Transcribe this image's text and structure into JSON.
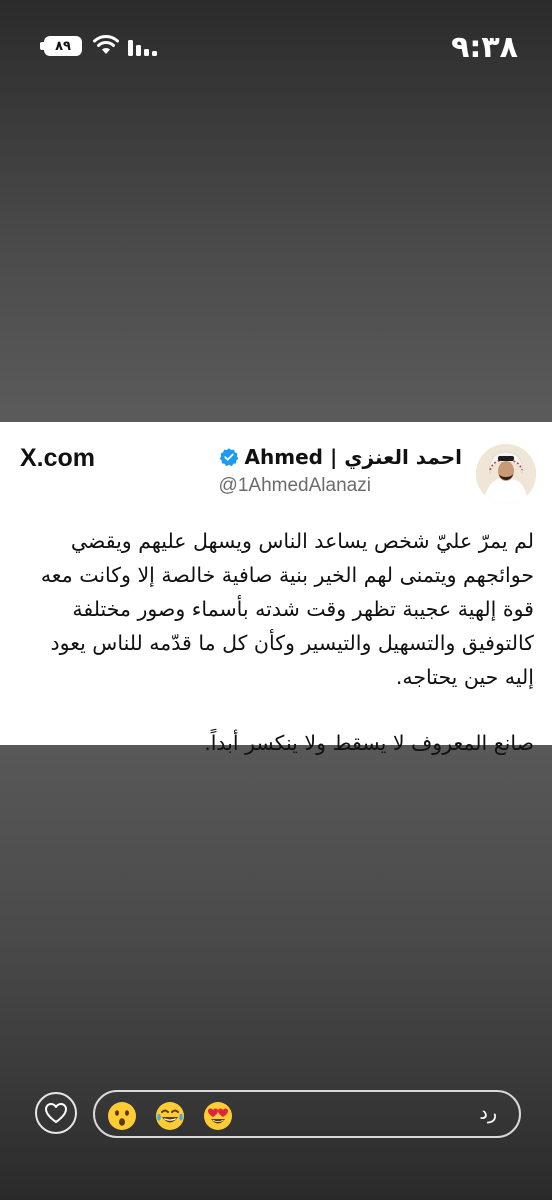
{
  "status_bar": {
    "time": "٩:٣٨",
    "battery": "٨٩"
  },
  "tweet_card": {
    "brand": "X.com",
    "author_name": "احمد العنزي | Ahmed",
    "author_handle": "@1AhmedAlanazi",
    "body_paragraph_1": "لم يمرّ عليّ شخص يساعد الناس ويسهل عليهم ويقضي حوائجهم ويتمنى لهم الخير بنية صافية خالصة إلا وكانت معه قوة إلهية عجيبة تظهر وقت شدته بأسماء وصور مختلفة كالتوفيق والتسهيل والتيسير وكأن كل ما قدّمه للناس يعود إليه حين يحتاجه.",
    "body_paragraph_2": "صانع المعروف لا يسقط ولا ينكسر أبداً."
  },
  "reply_bar": {
    "placeholder": "رد",
    "reactions": [
      "surprised-face",
      "laughing-tears-face",
      "heart-eyes-face"
    ],
    "like_icon": "heart-outline"
  },
  "colors": {
    "verified": "#1D9BF0",
    "card_bg": "#FFFFFF",
    "handle": "#6B6B6B"
  }
}
